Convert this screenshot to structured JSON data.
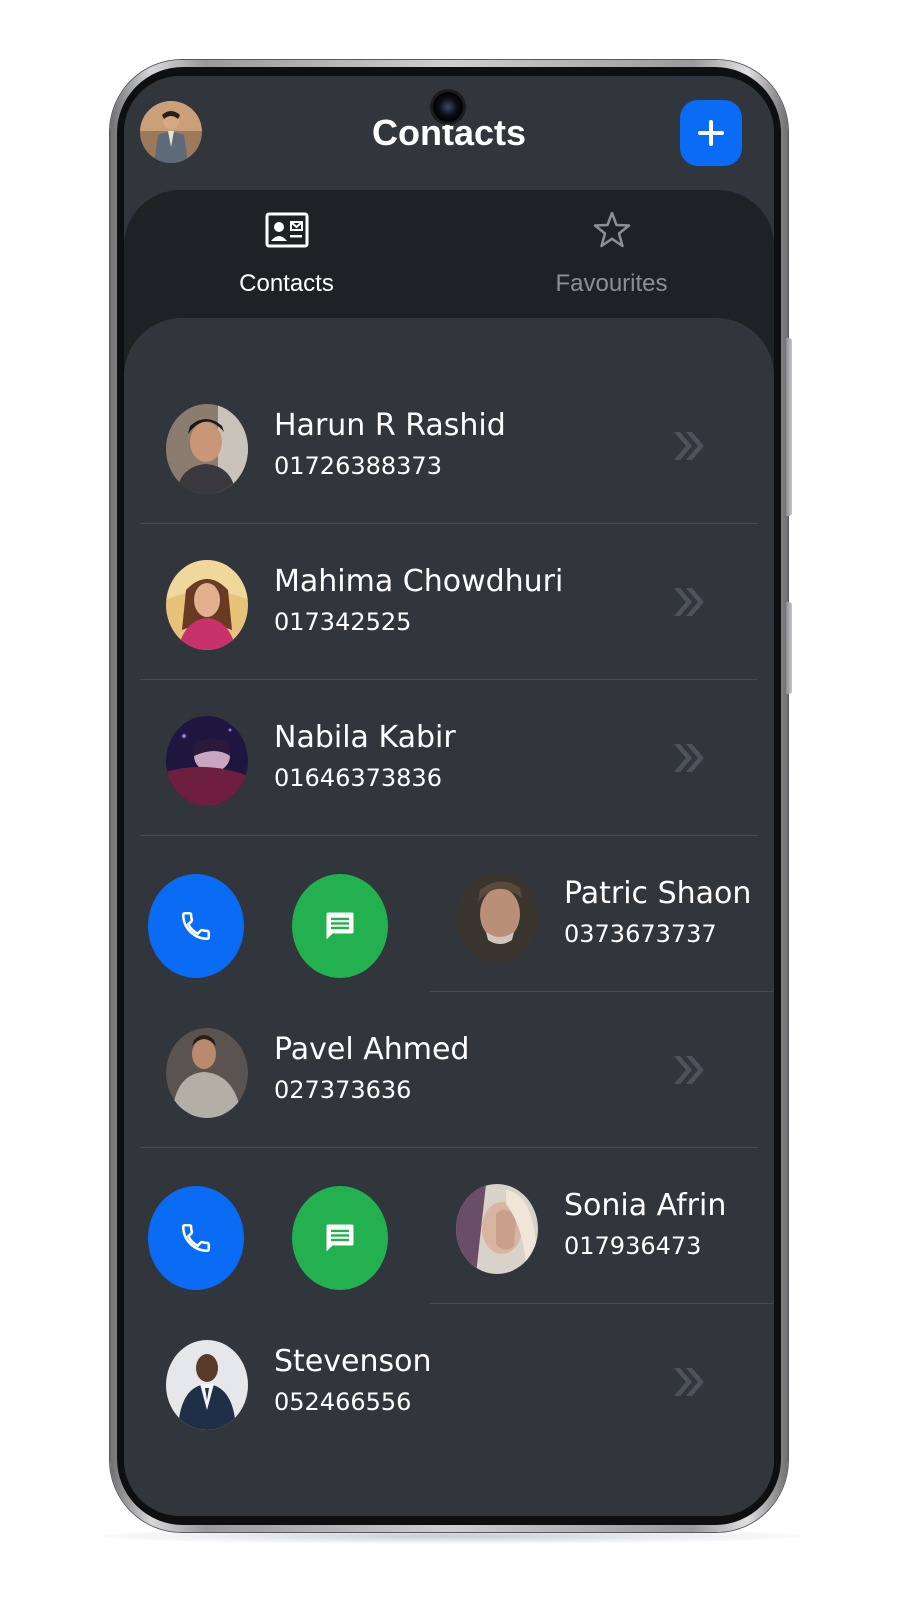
{
  "header": {
    "title": "Contacts",
    "add_icon": "plus-icon",
    "accent_color": "#0a6cf5"
  },
  "tabs": [
    {
      "label": "Contacts",
      "icon": "contact-card-icon",
      "active": true
    },
    {
      "label": "Favourites",
      "icon": "star-icon",
      "active": false
    }
  ],
  "contacts": [
    {
      "name": "Harun R Rashid",
      "phone": "01726388373",
      "state": "normal"
    },
    {
      "name": "Mahima Chowdhuri",
      "phone": "017342525",
      "state": "normal"
    },
    {
      "name": "Nabila Kabir",
      "phone": "01646373836",
      "state": "normal"
    },
    {
      "name": "Patric Shaon",
      "phone": "0373673737",
      "state": "swiped"
    },
    {
      "name": "Pavel Ahmed",
      "phone": "027373636",
      "state": "normal"
    },
    {
      "name": "Sonia Afrin",
      "phone": "017936473",
      "state": "swiped"
    },
    {
      "name": "Stevenson",
      "phone": "052466556",
      "state": "normal"
    }
  ],
  "swipe_actions": {
    "call_icon": "phone-icon",
    "call_color": "#0a6cf5",
    "message_icon": "message-icon",
    "message_color": "#23b04f"
  },
  "row_icon": "double-chevron-right-icon"
}
